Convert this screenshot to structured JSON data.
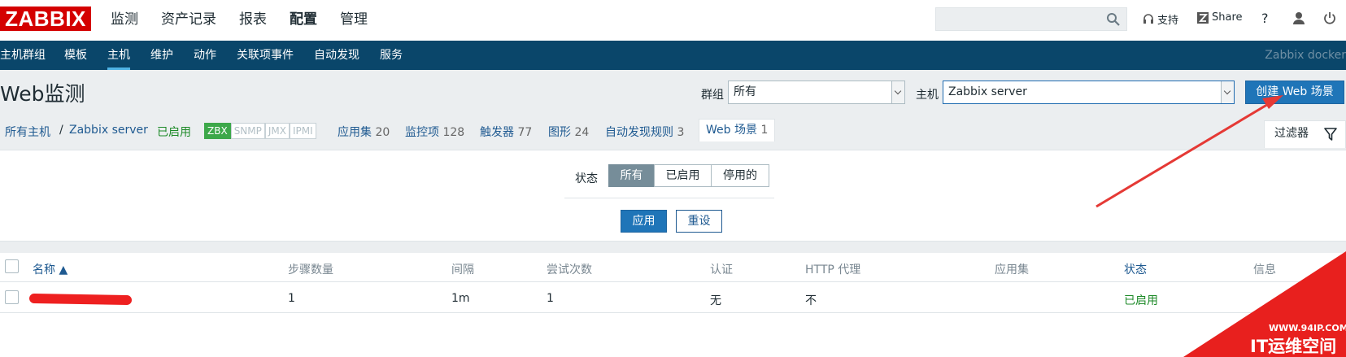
{
  "topbar": {
    "logo": "ZABBIX",
    "menu": [
      "监测",
      "资产记录",
      "报表",
      "配置",
      "管理"
    ],
    "active_menu": "配置",
    "support": "支持",
    "share": "Share",
    "help": "?"
  },
  "subnav": {
    "items": [
      "主机群组",
      "模板",
      "主机",
      "维护",
      "动作",
      "关联项事件",
      "自动发现",
      "服务"
    ],
    "active": "主机",
    "server_name": "Zabbix docker"
  },
  "header": {
    "title": "Web监测",
    "group_label": "群组",
    "group_value": "所有",
    "host_label": "主机",
    "host_value": "Zabbix server",
    "create_button": "创建 Web 场景"
  },
  "hostnav": {
    "all_hosts": "所有主机",
    "separator": "/",
    "host": "Zabbix server",
    "status": "已启用",
    "availability": [
      "ZBX",
      "SNMP",
      "JMX",
      "IPMI"
    ],
    "applications": {
      "label": "应用集",
      "count": "20"
    },
    "items": {
      "label": "监控项",
      "count": "128"
    },
    "triggers": {
      "label": "触发器",
      "count": "77"
    },
    "graphs": {
      "label": "图形",
      "count": "24"
    },
    "discovery": {
      "label": "自动发现规则",
      "count": "3"
    },
    "web": {
      "label": "Web 场景",
      "count": "1"
    },
    "filter_tab": "过滤器"
  },
  "filter": {
    "status_label": "状态",
    "options": [
      "所有",
      "已启用",
      "停用的"
    ],
    "selected": "所有",
    "apply": "应用",
    "reset": "重设"
  },
  "table": {
    "columns": [
      "名称 ▲",
      "步骤数量",
      "间隔",
      "尝试次数",
      "认证",
      "HTTP 代理",
      "应用集",
      "状态",
      "信息"
    ],
    "rows": [
      {
        "name": "",
        "steps": "1",
        "interval": "1m",
        "attempts": "1",
        "auth": "无",
        "proxy": "不",
        "application": "",
        "status": "已启用",
        "info": ""
      }
    ]
  },
  "watermark": {
    "url": "WWW.94IP.COM",
    "text": "IT运维空间"
  },
  "colors": {
    "logo": "#d40000",
    "subnav": "#0a466a",
    "primary": "#1f75b8",
    "enabled": "#1d8a28",
    "arrow": "#e53935"
  }
}
